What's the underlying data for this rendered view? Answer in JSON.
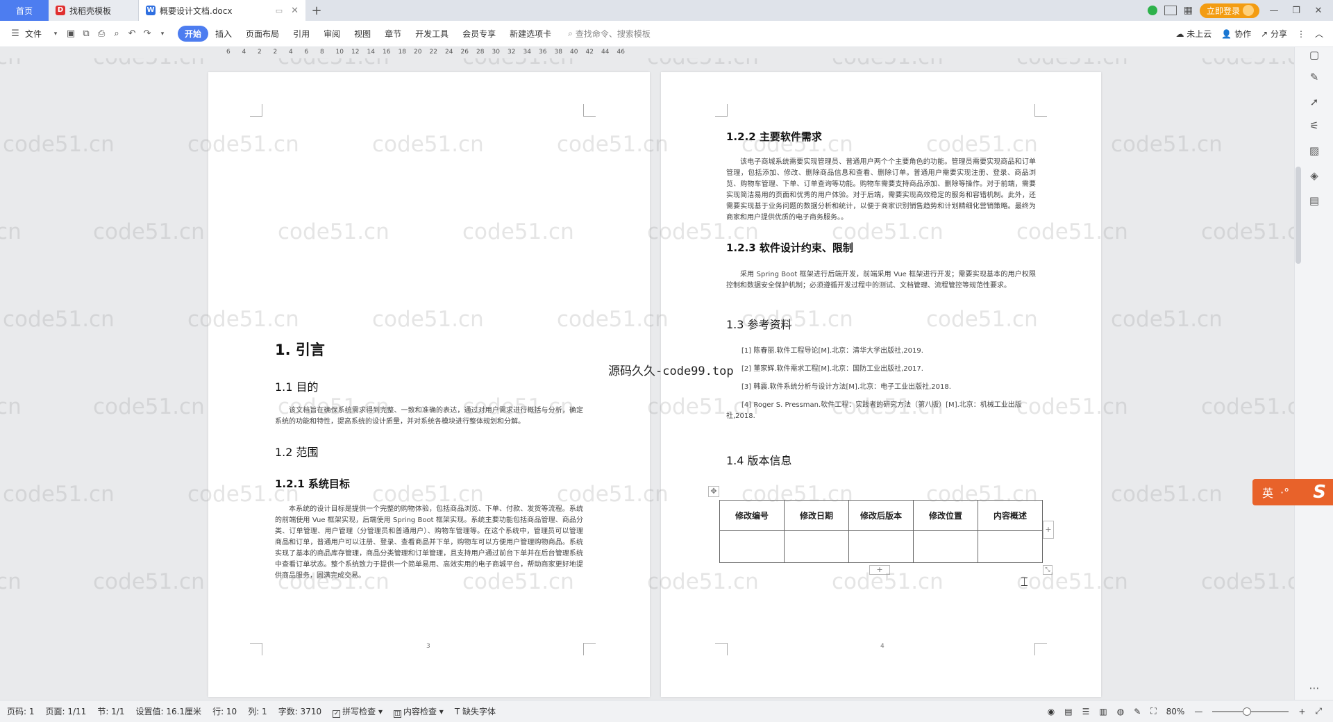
{
  "titlebar": {
    "tabs": [
      {
        "label": "首页"
      },
      {
        "label": "找稻壳模板"
      },
      {
        "label": "概要设计文档.docx"
      }
    ],
    "login_label": "立即登录"
  },
  "menubar": {
    "file_label": "文件",
    "items": [
      "开始",
      "插入",
      "页面布局",
      "引用",
      "审阅",
      "视图",
      "章节",
      "开发工具",
      "会员专享",
      "新建选项卡"
    ],
    "search_placeholder": "查找命令、搜索模板",
    "cloud_label": "未上云",
    "collab_label": "协作",
    "share_label": "分享"
  },
  "ruler": {
    "numbers": [
      "6",
      "4",
      "2",
      "2",
      "4",
      "6",
      "8",
      "10",
      "12",
      "14",
      "16",
      "18",
      "20",
      "22",
      "24",
      "26",
      "28",
      "30",
      "32",
      "34",
      "36",
      "38",
      "40",
      "42",
      "44",
      "46"
    ]
  },
  "page_left": {
    "h1": "1. 引言",
    "s11_title": "1.1 目的",
    "s11_body": "该文档旨在确保系统需求得到完整、一致和准确的表达，通过对用户需求进行概括与分析，确定系统的功能和特性，提高系统的设计质量，并对系统各模块进行整体规划和分解。",
    "s12_title": "1.2 范围",
    "s121_title": "1.2.1 系统目标",
    "s121_body": "本系统的设计目标是提供一个完整的购物体验，包括商品浏览、下单、付款、发货等流程。系统的前端使用 Vue 框架实现，后端使用 Spring Boot 框架实现。系统主要功能包括商品管理、商品分类、订单管理、用户管理（分管理员和普通用户）、购物车管理等。在这个系统中，管理员可以管理商品和订单，普通用户可以注册、登录、查看商品并下单，购物车可以方便用户管理购物商品。系统实现了基本的商品库存管理，商品分类管理和订单管理，且支持用户通过前台下单并在后台管理系统中查看订单状态。整个系统致力于提供一个简单易用、高效实用的电子商城平台，帮助商家更好地提供商品服务，圆满完成交易。",
    "page_number": "3"
  },
  "page_right": {
    "s122_title": "1.2.2 主要软件需求",
    "s122_body": "该电子商城系统需要实现管理员、普通用户两个个主要角色的功能。管理员需要实现商品和订单管理，包括添加、修改、删除商品信息和查看、删除订单。普通用户需要实现注册、登录、商品浏览、购物车管理、下单、订单查询等功能。购物车需要支持商品添加、删除等操作。对于前端，需要实现简洁易用的页面和优秀的用户体验。对于后端，需要实现高效稳定的服务和容错机制。此外，还需要实现基于业务问题的数据分析和统计，以便于商家识别销售趋势和计划精细化营销策略。最终为商家和用户提供优质的电子商务服务。。",
    "s123_title": "1.2.3 软件设计约束、限制",
    "s123_body": "采用 Spring Boot 框架进行后端开发，前端采用 Vue 框架进行开发；需要实现基本的用户权限控制和数据安全保护机制；必须遵循开发过程中的测试、文档管理、流程管控等规范性要求。",
    "s13_title": "1.3 参考资料",
    "refs": [
      "[1] 陈春丽.软件工程导论[M].北京：清华大学出版社,2019.",
      "[2] 董家辉.软件需求工程[M].北京：国防工业出版社,2017.",
      "[3] 韩震.软件系统分析与设计方法[M].北京：电子工业出版社,2018.",
      "[4] Roger S. Pressman.软件工程：实践者的研究方法（第八版）[M].北京：机械工业出版社,2018."
    ],
    "s14_title": "1.4 版本信息",
    "table_headers": [
      "修改编号",
      "修改日期",
      "修改后版本",
      "修改位置",
      "内容概述"
    ],
    "page_number": "4"
  },
  "overlay_text": "源码久久-code99.top",
  "watermark_text": "code51.cn",
  "ime": {
    "label": "英"
  },
  "statusbar": {
    "page_code": "页码: 1",
    "page": "页面: 1/11",
    "section": "节: 1/1",
    "setting": "设置值: 16.1厘米",
    "row": "行: 10",
    "col": "列: 1",
    "words": "字数: 3710",
    "spell": "拼写检查",
    "content_check": "内容检查",
    "missing_font": "缺失字体",
    "zoom": "80%",
    "zoom_level": 0.45
  },
  "colors": {
    "accent": "#4d7df0",
    "login": "#f39c12",
    "ime": "#e8622a"
  }
}
